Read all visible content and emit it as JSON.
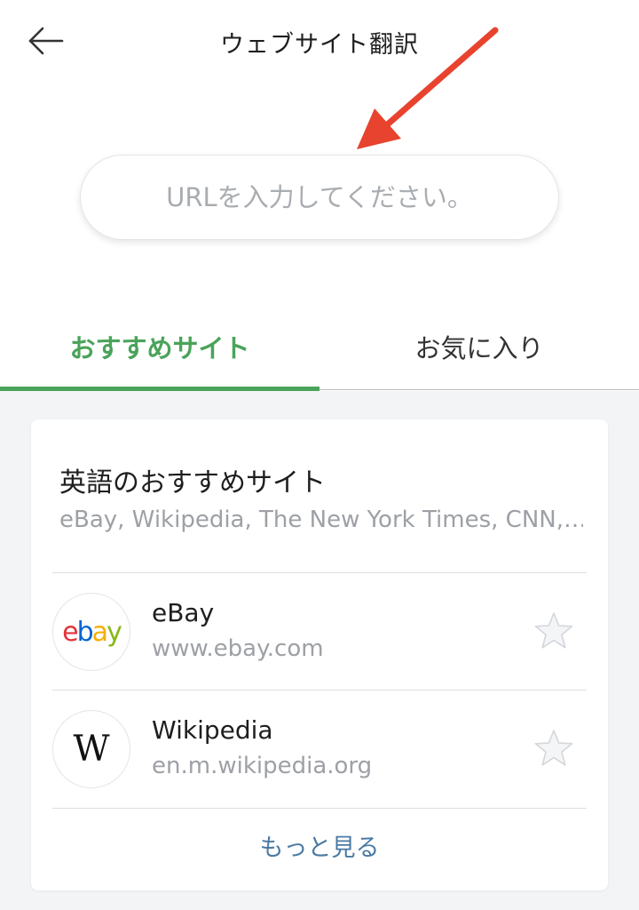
{
  "header": {
    "title": "ウェブサイト翻訳",
    "back_icon": "arrow-left-icon"
  },
  "url_field": {
    "placeholder": "URLを入力してください。",
    "value": ""
  },
  "annotation": {
    "color": "#e8432e"
  },
  "tabs": [
    {
      "label": "おすすめサイト",
      "active": true
    },
    {
      "label": "お気に入り",
      "active": false
    }
  ],
  "colors": {
    "accent": "#4aa35a",
    "link": "#4a7aa3"
  },
  "recommended": {
    "title": "英語のおすすめサイト",
    "subtitle": "eBay, Wikipedia, The New York Times, CNN,…",
    "sites": [
      {
        "name": "eBay",
        "url": "www.ebay.com",
        "logo_letters": [
          "e",
          "b",
          "a",
          "y"
        ],
        "favorite": false
      },
      {
        "name": "Wikipedia",
        "url": "en.m.wikipedia.org",
        "logo_letters": [
          "W"
        ],
        "favorite": false
      }
    ],
    "more_label": "もっと見る"
  }
}
